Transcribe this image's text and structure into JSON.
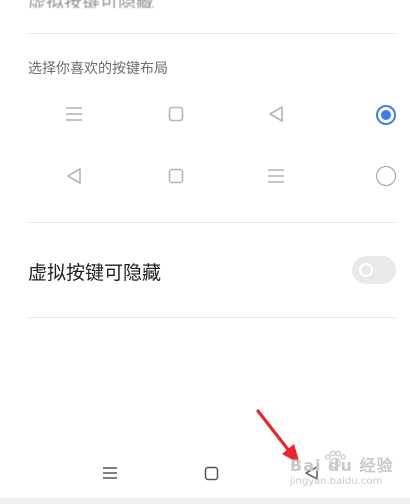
{
  "top_partial_text": "虚拟按键可隐藏",
  "layout_section": {
    "label": "选择你喜欢的按键布局",
    "options": [
      {
        "icons": [
          "menu-icon",
          "square-icon",
          "back-triangle-icon"
        ],
        "selected": true
      },
      {
        "icons": [
          "back-triangle-icon",
          "square-icon",
          "menu-icon"
        ],
        "selected": false
      }
    ]
  },
  "hide_setting": {
    "label": "虚拟按键可隐藏",
    "enabled": false
  },
  "navbar": {
    "icons": [
      "menu-icon",
      "square-icon",
      "back-triangle-icon"
    ]
  },
  "watermark": {
    "main": "Bai du 经验",
    "sub": "jingyan.baidu.com"
  },
  "colors": {
    "accent": "#3a7bf6",
    "icon_gray": "#b5b5b5",
    "annotation_arrow": "#e8262b"
  }
}
